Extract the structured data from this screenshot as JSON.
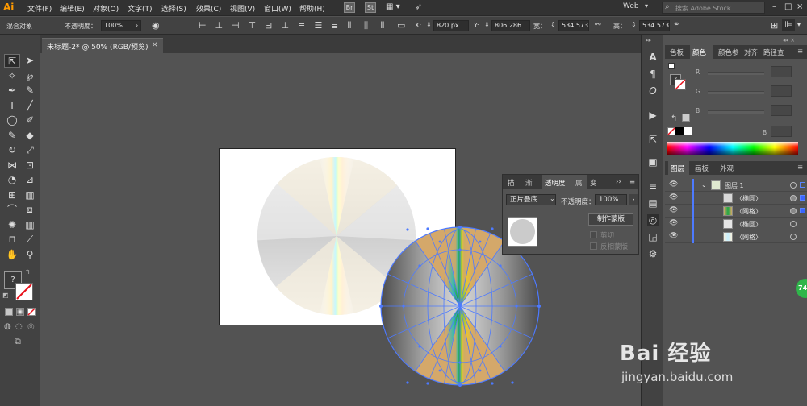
{
  "app": {
    "logo": "Ai"
  },
  "menu": [
    "文件(F)",
    "编辑(E)",
    "对象(O)",
    "文字(T)",
    "选择(S)",
    "效果(C)",
    "视图(V)",
    "窗口(W)",
    "帮助(H)"
  ],
  "menu_badges": [
    "Br",
    "St"
  ],
  "workspace": "Web",
  "search": {
    "placeholder": "搜索 Adobe Stock"
  },
  "control_bar": {
    "mixed_objects": "混合对象",
    "opacity_label": "不透明度：",
    "opacity_value": "100%",
    "x_label": "X:",
    "x_value": "820 px",
    "y_label": "Y:",
    "y_value": "806.286",
    "w_label": "宽：",
    "w_value": "534.573",
    "h_label": "高：",
    "h_value": "534.573"
  },
  "document_tab": {
    "title": "未标题-2* @ 50% (RGB/预览)",
    "close": "×"
  },
  "transparency_panel": {
    "tabs": [
      "描",
      "渐",
      "透明度",
      "属",
      "变",
      "››"
    ],
    "active_tab": "透明度",
    "blend_mode": "正片叠底",
    "opacity_label": "不透明度：",
    "opacity_value": "100%",
    "make_mask": "制作蒙版",
    "clip": "剪切",
    "invert_mask": "反相蒙版"
  },
  "color_panel": {
    "tabs": [
      "色板",
      "颜色",
      "颜色参",
      "对齐",
      "路径查"
    ],
    "active_tab": "颜色",
    "channels": [
      "R",
      "G",
      "B"
    ],
    "b_label": "B"
  },
  "layers_panel": {
    "tabs": [
      "图层",
      "画板",
      "外观"
    ],
    "active_tab": "图层",
    "rows": [
      {
        "name": "图层 1",
        "expanded": true
      },
      {
        "name": "〈椭圆〉"
      },
      {
        "name": "〈网格〉"
      },
      {
        "name": "〈椭圆〉"
      },
      {
        "name": "〈网格〉"
      }
    ]
  },
  "badge": "74",
  "watermark": {
    "brand": "Bai 经验",
    "url": "jingyan.baidu.com"
  },
  "colors": {
    "accent_selection": "#4d7aff",
    "mesh_orange": "#d4a86a",
    "badge_green": "#2fb54a"
  }
}
